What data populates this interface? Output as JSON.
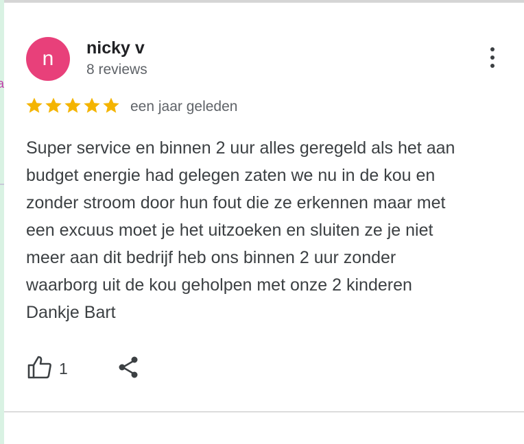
{
  "review": {
    "author": {
      "initial": "n",
      "name": "nicky v",
      "review_count": "8 reviews",
      "avatar_color": "#e8407a"
    },
    "rating": 5,
    "rating_max": 5,
    "star_color": "#f4b400",
    "date": "een jaar geleden",
    "text": "Super service en binnen 2 uur alles geregeld als het aan\nbudget energie had gelegen zaten we nu in de kou en\nzonder stroom door hun fout die ze erkennen maar met\neen excuus moet je het uitzoeken en sluiten ze je niet\nmeer aan dit bedrijf heb ons binnen 2 uur zonder\nwaarborg uit de kou geholpen met onze 2 kinderen\nDankje Bart",
    "likes": "1"
  },
  "icons": {
    "more": "more-vert-icon",
    "like": "thumb-up-icon",
    "share": "share-icon",
    "star": "star-icon"
  },
  "background_fragment": {
    "left_letter": "a"
  }
}
